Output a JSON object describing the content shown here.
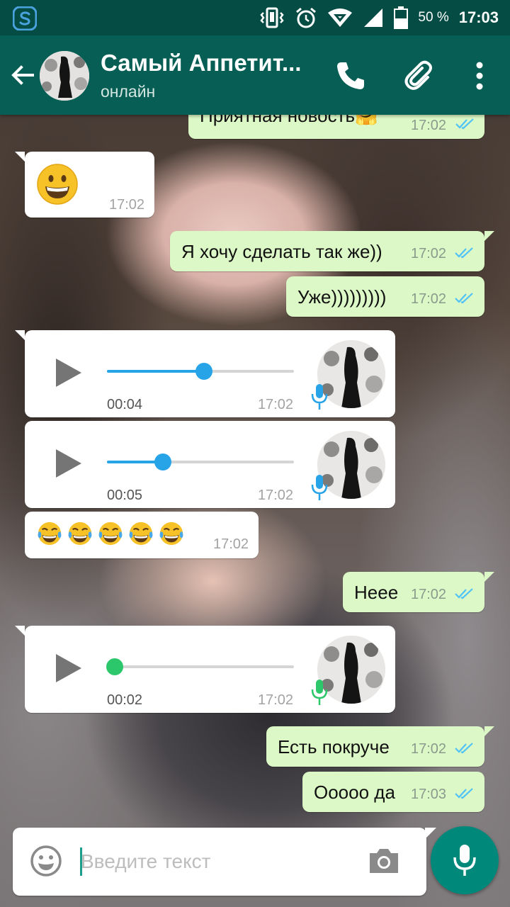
{
  "status_bar": {
    "battery_percent": "50 %",
    "time": "17:03"
  },
  "header": {
    "title": "Самый Аппетит...",
    "subtitle": "онлайн"
  },
  "messages": [
    {
      "type": "text",
      "dir": "out",
      "text": "Приятная новость🤗",
      "time": "17:02"
    },
    {
      "type": "emoji",
      "dir": "in",
      "emoji": "grinning-face",
      "time": "17:02"
    },
    {
      "type": "text",
      "dir": "out",
      "text": "Я хочу сделать так же))",
      "time": "17:02"
    },
    {
      "type": "text",
      "dir": "out",
      "text": "Уже)))))))))",
      "time": "17:02"
    },
    {
      "type": "voice",
      "dir": "in",
      "duration": "00:04",
      "progress": 0.52,
      "time": "17:02"
    },
    {
      "type": "voice",
      "dir": "in",
      "duration": "00:05",
      "progress": 0.3,
      "time": "17:02"
    },
    {
      "type": "emoji-row",
      "dir": "in",
      "emoji": "face-with-tears-of-joy",
      "count": 5,
      "time": "17:02"
    },
    {
      "type": "text",
      "dir": "out",
      "text": "Неее",
      "time": "17:02"
    },
    {
      "type": "voice",
      "dir": "in",
      "duration": "00:02",
      "progress": 0.0,
      "played": false,
      "time": "17:02"
    },
    {
      "type": "text",
      "dir": "out",
      "text": "Есть покруче",
      "time": "17:02"
    },
    {
      "type": "text",
      "dir": "out",
      "text": "Ооооо да",
      "time": "17:03"
    }
  ],
  "composer": {
    "placeholder": "Введите текст"
  },
  "colors": {
    "header": "#075e54",
    "status_bar": "#054d44",
    "outgoing_bubble": "#dcf8c6",
    "incoming_bubble": "#ffffff",
    "read_ticks": "#4fc3f7",
    "voice_played": "#27a3e8",
    "voice_unplayed": "#2dc76b",
    "fab": "#00897b"
  }
}
